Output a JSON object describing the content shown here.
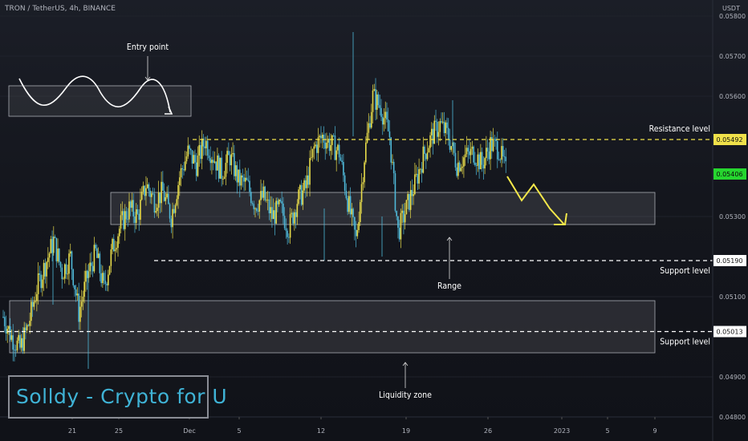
{
  "header": {
    "symbol": "TRON / TetherUS, 4h, BINANCE",
    "currency": "USDT"
  },
  "brand": {
    "text": "Solldy - Crypto for U"
  },
  "colors": {
    "bull": "#e8dc4a",
    "bear": "#4fb8d8",
    "support": "#ffffff",
    "resistance": "#f0e14a",
    "arrow": "#f4e84a",
    "current_price": "#26d62f"
  },
  "chart_data": {
    "type": "candlestick",
    "interval": "4h",
    "y_axis": {
      "ticks": [
        0.058,
        0.057,
        0.056,
        0.053,
        0.051,
        0.049,
        0.048
      ],
      "tick_labels": [
        "0.05800",
        "0.05700",
        "0.05600",
        "0.05300",
        "0.05100",
        "0.04900",
        "0.04800"
      ],
      "ylim": [
        0.048,
        0.0582
      ]
    },
    "x_axis": {
      "labels": [
        "21",
        "25",
        "Dec",
        "5",
        "12",
        "19",
        "26",
        "2023",
        "5",
        "9"
      ]
    },
    "levels": [
      {
        "name": "Resistance level",
        "price": 0.05492,
        "label": "0.05492"
      },
      {
        "name": "Support level",
        "price": 0.0519,
        "label": "0.05190"
      },
      {
        "name": "Support level",
        "price": 0.05013,
        "label": "0.05013"
      }
    ],
    "current_price": {
      "value": 0.05406,
      "label": "0.05406"
    },
    "zones": [
      {
        "name": "Range",
        "from": 0.0528,
        "to": 0.0536
      },
      {
        "name": "Liquidity zone",
        "from": 0.0496,
        "to": 0.0509
      }
    ],
    "annotations": [
      "Entry point",
      "Range",
      "Liquidity zone"
    ],
    "close_path": [
      0.0505,
      0.05,
      0.0497,
      0.0503,
      0.0512,
      0.0518,
      0.0524,
      0.0516,
      0.052,
      0.0506,
      0.0515,
      0.0521,
      0.0512,
      0.0522,
      0.0528,
      0.0532,
      0.053,
      0.0538,
      0.0534,
      0.0536,
      0.053,
      0.054,
      0.0546,
      0.0543,
      0.0549,
      0.0545,
      0.0541,
      0.0545,
      0.0539,
      0.0538,
      0.0533,
      0.0535,
      0.053,
      0.0532,
      0.0527,
      0.0534,
      0.0537,
      0.0547,
      0.055,
      0.0548,
      0.0546,
      0.0534,
      0.0524,
      0.0545,
      0.056,
      0.0557,
      0.055,
      0.0526,
      0.0532,
      0.0538,
      0.0545,
      0.055,
      0.0553,
      0.055,
      0.0543,
      0.0545,
      0.0546,
      0.0543,
      0.0548,
      0.0547,
      0.054
    ],
    "projection": [
      0.054,
      0.0534,
      0.0538,
      0.0532,
      0.0528
    ]
  },
  "labels": {
    "resistance": "Resistance level",
    "support1": "Support level",
    "support2": "Support level",
    "range": "Range",
    "liquidity": "Liquidity zone",
    "entry": "Entry point"
  }
}
